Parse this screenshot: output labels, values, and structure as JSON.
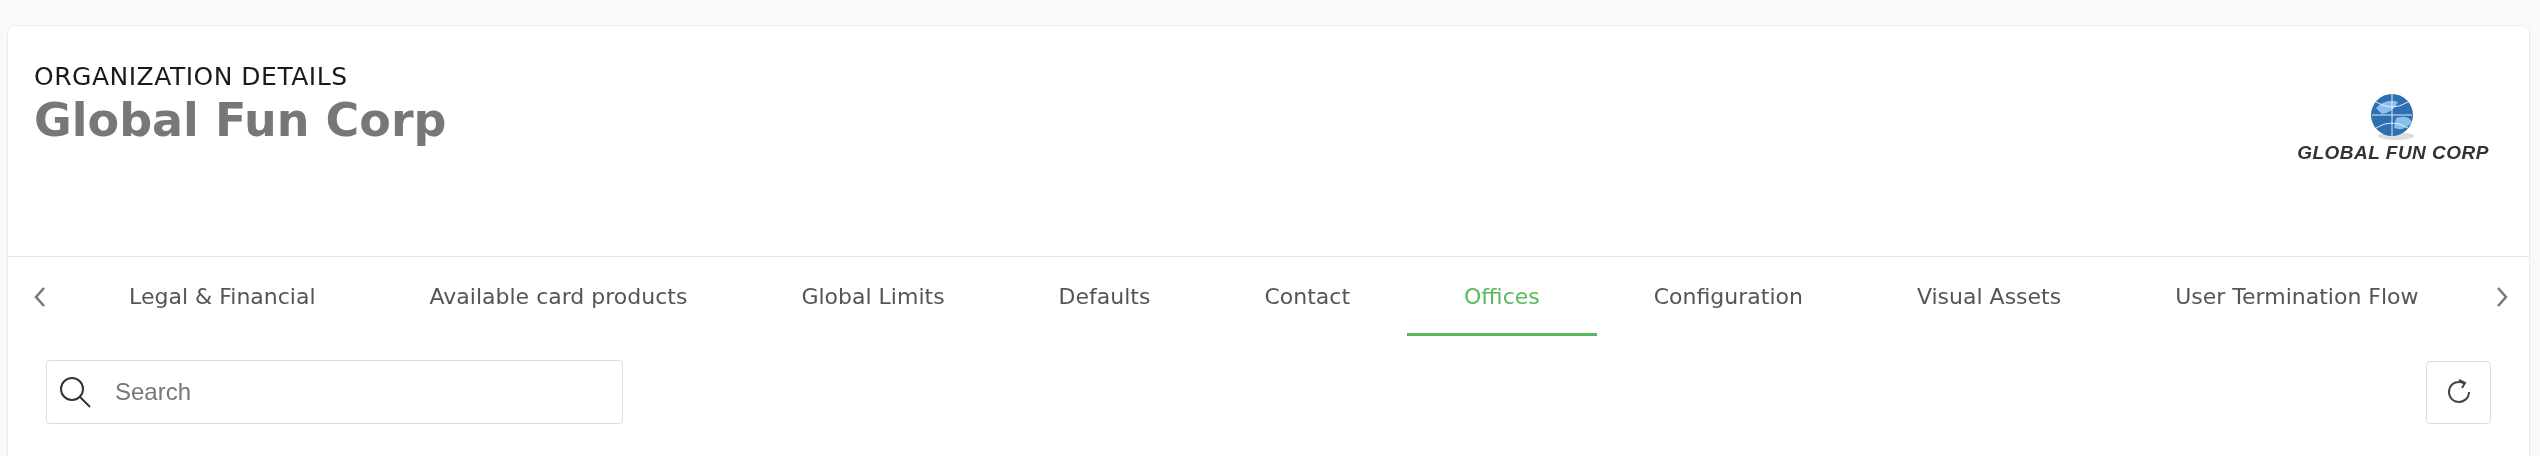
{
  "header": {
    "eyebrow": "ORGANIZATION DETAILS",
    "title": "Global Fun Corp",
    "logo_text": "GLOBAL FUN CORP"
  },
  "tabs": [
    {
      "label": "Legal & Financial",
      "selected": false
    },
    {
      "label": "Available card products",
      "selected": false
    },
    {
      "label": "Global Limits",
      "selected": false
    },
    {
      "label": "Defaults",
      "selected": false
    },
    {
      "label": "Contact",
      "selected": false
    },
    {
      "label": "Offices",
      "selected": true
    },
    {
      "label": "Configuration",
      "selected": false
    },
    {
      "label": "Visual Assets",
      "selected": false
    },
    {
      "label": "User Termination Flow",
      "selected": false
    }
  ],
  "search": {
    "placeholder": "Search"
  }
}
